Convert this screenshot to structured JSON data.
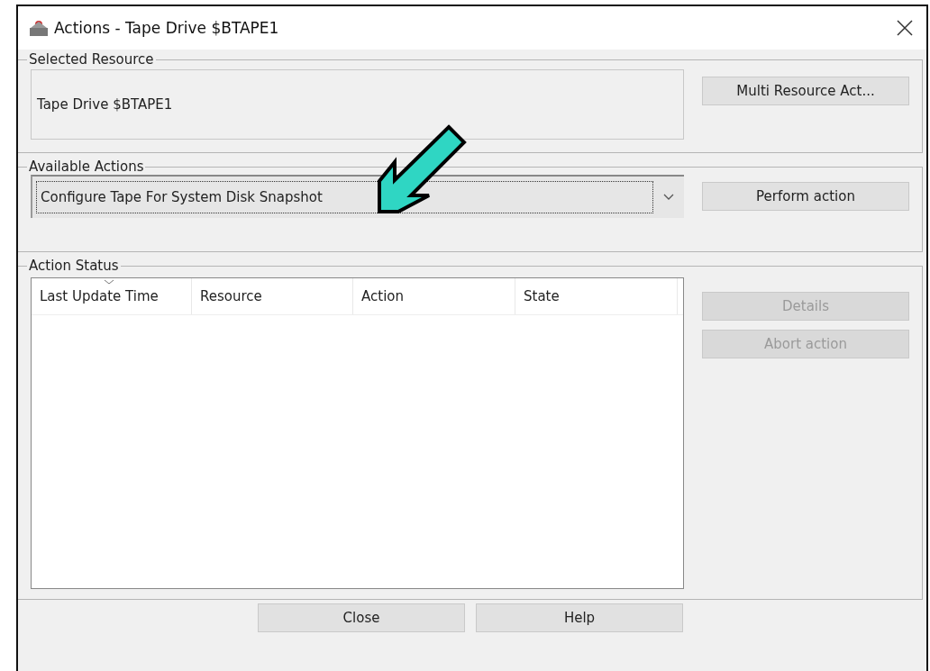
{
  "window": {
    "title": "Actions - Tape Drive $BTAPE1"
  },
  "selected_resource": {
    "title": "Selected Resource",
    "value": "Tape Drive $BTAPE1",
    "button": {
      "label": "Multi Resource Act...",
      "disabled": false
    }
  },
  "available_actions": {
    "title": "Available Actions",
    "dropdown": {
      "value": "Configure Tape For System Disk Snapshot"
    },
    "button": {
      "label": "Perform action",
      "disabled": false
    }
  },
  "action_status": {
    "title": "Action Status",
    "table": {
      "columns": [
        {
          "label": "Last Update Time",
          "sorted": true
        },
        {
          "label": "Resource",
          "sorted": false
        },
        {
          "label": "Action",
          "sorted": false
        },
        {
          "label": "State",
          "sorted": false
        }
      ]
    },
    "buttons": [
      {
        "label": "Details",
        "disabled": true
      },
      {
        "label": "Abort action",
        "disabled": true
      }
    ]
  },
  "footer_buttons": [
    {
      "label": "Close",
      "disabled": false
    },
    {
      "label": "Help",
      "disabled": false
    }
  ]
}
